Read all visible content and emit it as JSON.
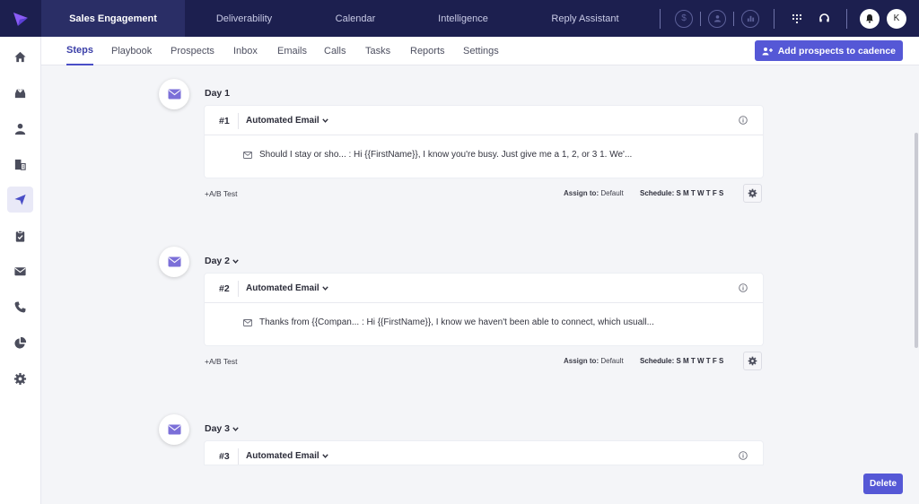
{
  "header": {
    "tabs": [
      {
        "label": "Sales Engagement",
        "active": true
      },
      {
        "label": "Deliverability"
      },
      {
        "label": "Calendar"
      },
      {
        "label": "Intelligence"
      },
      {
        "label": "Reply Assistant"
      }
    ],
    "right_icons": [
      "dollar-icon",
      "user-circle-icon",
      "bar-chart-icon",
      "dialpad-icon",
      "headset-icon",
      "bell-icon"
    ],
    "avatar_initial": "K"
  },
  "sidebar": {
    "items": [
      {
        "icon": "home-icon"
      },
      {
        "icon": "inbox-tray-icon"
      },
      {
        "icon": "person-icon"
      },
      {
        "icon": "building-icon"
      },
      {
        "icon": "paper-plane-icon",
        "active": true
      },
      {
        "icon": "clipboard-check-icon"
      },
      {
        "icon": "envelope-icon"
      },
      {
        "icon": "phone-icon"
      },
      {
        "icon": "pie-chart-icon"
      },
      {
        "icon": "gear-icon"
      }
    ]
  },
  "subnav": {
    "tabs": [
      {
        "label": "Steps",
        "active": true
      },
      {
        "label": "Playbook"
      },
      {
        "label": "Prospects"
      },
      {
        "label": "Inbox"
      },
      {
        "label": "Emails"
      },
      {
        "label": "Calls"
      },
      {
        "label": "Tasks"
      },
      {
        "label": "Reports"
      },
      {
        "label": "Settings"
      }
    ],
    "add_button": "Add prospects to cadence"
  },
  "steps": [
    {
      "day": "Day 1",
      "number": "#1",
      "type": "Automated Email",
      "preview": "Should I stay or sho... : Hi {{FirstName}}, I know you're busy. Just give me a 1, 2, or 3 1. We'...",
      "ab_test": "+A/B Test",
      "assign_label": "Assign to:",
      "assign_value": "Default",
      "schedule_label": "Schedule:",
      "schedule_days": "S M T W T F S"
    },
    {
      "day": "Day 2",
      "number": "#2",
      "type": "Automated Email",
      "preview": "Thanks from {{Compan... : Hi {{FirstName}}, I know we haven't been able to connect, which usuall...",
      "ab_test": "+A/B Test",
      "assign_label": "Assign to:",
      "assign_value": "Default",
      "schedule_label": "Schedule:",
      "schedule_days": "S M T W T F S"
    },
    {
      "day": "Day 3",
      "number": "#3",
      "type": "Automated Email"
    }
  ],
  "delete_button": "Delete",
  "colors": {
    "topbar": "#1c1f4f",
    "accent": "#5558d6",
    "mail_icon": "#7b6fd8"
  }
}
